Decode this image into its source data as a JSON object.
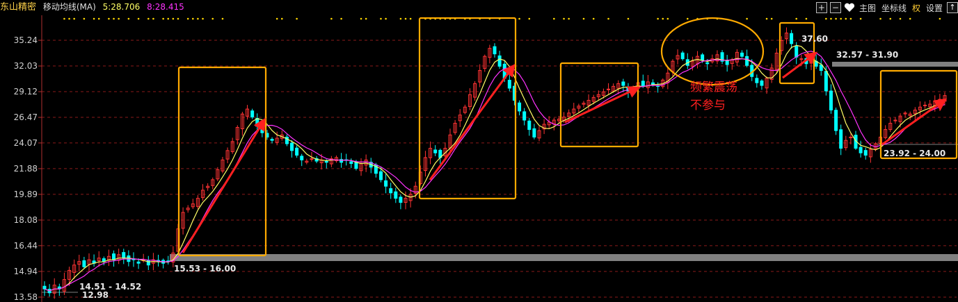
{
  "header": {
    "stock_name": "东山精密",
    "indicator": "移动均线(MA)",
    "ma1": "5:28.706",
    "ma2": "8:28.415"
  },
  "toolbar": {
    "plus": "+",
    "minus": "−",
    "main_chart": "主图",
    "coord_line": "坐标线",
    "rights": "权",
    "settings": "设置",
    "up_arrow": "↑"
  },
  "colors": {
    "up": "#ff3333",
    "down": "#00ffff",
    "ma5": "#ffff66",
    "ma8": "#ff33ff",
    "box": "#ffaa00",
    "zone": "#808080",
    "arrow": "#ff2020",
    "annotation": "#ff2020",
    "grid": "#8b1a1a",
    "axis_text": "#d0d0d0"
  },
  "chart_data": {
    "type": "candlestick",
    "y_ticks": [
      "35.24",
      "32.03",
      "29.12",
      "26.47",
      "24.07",
      "21.88",
      "19.89",
      "18.08",
      "16.44",
      "14.94",
      "13.58"
    ],
    "ylim": [
      13.58,
      37.0
    ],
    "scale": "log",
    "ma_legend": [
      {
        "name": "5",
        "value": 28.706
      },
      {
        "name": "8",
        "value": 28.415
      }
    ],
    "price_labels": [
      {
        "text": "15.53 - 16.00"
      },
      {
        "text": "14.51 - 14.52"
      },
      {
        "text": "12.98"
      },
      {
        "text": "32.57 - 31.90"
      },
      {
        "text": "37.60"
      },
      {
        "text": "23.92 - 24.00"
      }
    ],
    "annotations": [
      {
        "text": "频繁震荡"
      },
      {
        "text": "不参与"
      }
    ],
    "series": [
      {
        "name": "close",
        "values": [
          14.0,
          13.8,
          14.2,
          14.0,
          14.5,
          15.0,
          15.3,
          15.5,
          15.2,
          15.6,
          15.4,
          15.7,
          15.5,
          15.8,
          15.6,
          15.9,
          15.7,
          15.5,
          15.6,
          15.4,
          15.6,
          15.3,
          15.6,
          15.5,
          15.4,
          15.5,
          16.0,
          17.5,
          18.6,
          18.9,
          19.2,
          19.6,
          20.2,
          20.5,
          21.0,
          21.8,
          22.6,
          23.4,
          24.2,
          25.5,
          26.8,
          27.3,
          26.5,
          25.6,
          25.0,
          24.6,
          24.3,
          24.5,
          24.8,
          24.0,
          23.4,
          23.0,
          22.6,
          22.5,
          22.7,
          22.5,
          22.6,
          22.4,
          22.7,
          22.8,
          22.4,
          22.6,
          22.3,
          21.9,
          22.3,
          22.6,
          22.0,
          21.5,
          21.0,
          20.5,
          20.0,
          19.6,
          19.3,
          19.6,
          19.9,
          20.5,
          21.6,
          22.8,
          23.6,
          23.2,
          22.8,
          23.6,
          24.8,
          25.9,
          26.7,
          27.5,
          28.8,
          30.0,
          31.5,
          33.2,
          34.2,
          33.5,
          32.0,
          30.6,
          29.5,
          28.2,
          27.1,
          26.2,
          25.3,
          24.6,
          25.2,
          25.8,
          26.0,
          26.2,
          26.3,
          26.5,
          26.9,
          27.3,
          27.6,
          27.9,
          28.2,
          28.5,
          28.8,
          29.1,
          29.4,
          29.7,
          30.0,
          29.8,
          29.2,
          29.6,
          30.1,
          29.7,
          30.2,
          29.9,
          29.7,
          30.4,
          31.2,
          32.6,
          33.3,
          32.9,
          32.1,
          32.6,
          33.2,
          32.7,
          32.3,
          32.9,
          33.4,
          32.6,
          32.2,
          32.8,
          33.7,
          33.2,
          32.1,
          30.8,
          30.1,
          29.8,
          30.6,
          31.8,
          33.6,
          35.2,
          36.2,
          34.8,
          33.1,
          32.9,
          32.3,
          32.6,
          32.0,
          31.5,
          29.2,
          27.2,
          25.2,
          23.6,
          24.3,
          24.6,
          23.6,
          23.2,
          23.0,
          23.5,
          24.0,
          24.6,
          25.3,
          25.9,
          26.2,
          26.6,
          26.9,
          26.8,
          27.2,
          27.5,
          27.7,
          27.8,
          28.1,
          28.3,
          28.7
        ]
      }
    ]
  }
}
